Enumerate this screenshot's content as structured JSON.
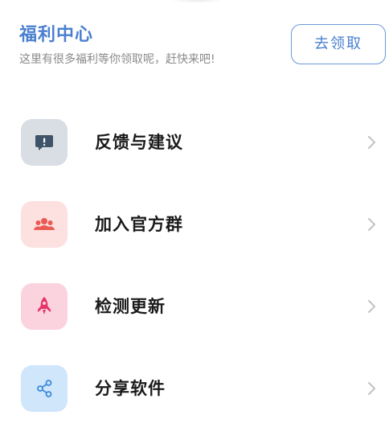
{
  "welfare": {
    "title": "福利中心",
    "subtitle": "这里有很多福利等你领取呢，赶快来吧!",
    "claim_button": "去领取"
  },
  "menu": {
    "items": [
      {
        "label": "反馈与建议",
        "icon": "feedback-icon",
        "icon_bg": "#d8dee4",
        "icon_color": "#3f5468"
      },
      {
        "label": "加入官方群",
        "icon": "group-icon",
        "icon_bg": "#fde0e0",
        "icon_color": "#ea5b53"
      },
      {
        "label": "检测更新",
        "icon": "rocket-icon",
        "icon_bg": "#fbd3de",
        "icon_color": "#e5356a"
      },
      {
        "label": "分享软件",
        "icon": "share-icon",
        "icon_bg": "#cfe6fb",
        "icon_color": "#3f8bd8"
      }
    ]
  },
  "colors": {
    "accent": "#4a7fd0",
    "chevron": "#c3c3c3"
  }
}
